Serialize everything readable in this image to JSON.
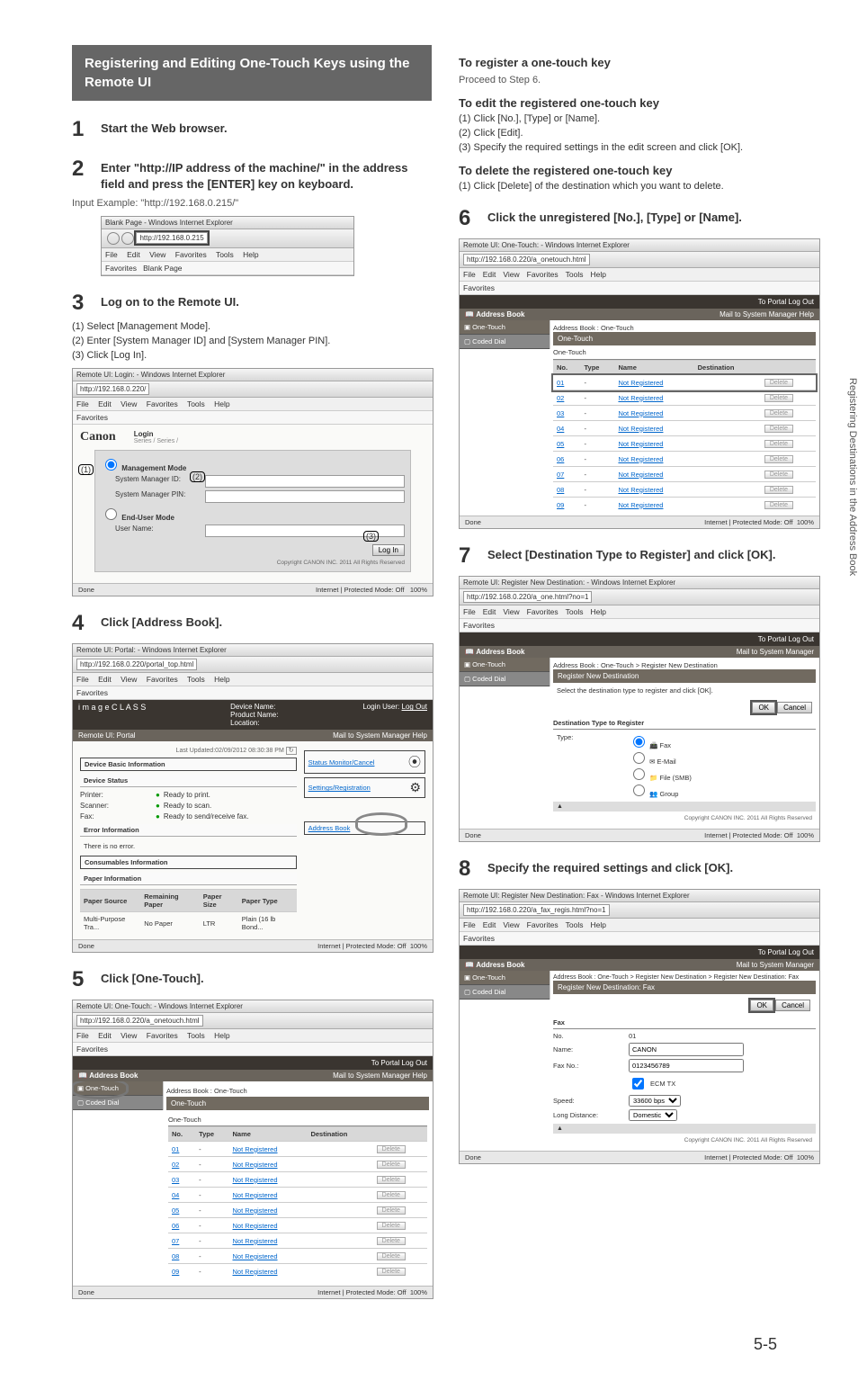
{
  "title": "Registering and Editing One-Touch Keys using the Remote UI",
  "side_tab": "Registering Destinations in the Address Book",
  "page_number": "5-5",
  "left": {
    "steps": {
      "s1": {
        "num": "1",
        "text": "Start the Web browser."
      },
      "s2": {
        "num": "2",
        "text": "Enter \"http://IP address of the machine/\" in the address field and press the [ENTER] key on keyboard.",
        "note": "Input Example: \"http://192.168.0.215/\""
      },
      "s3": {
        "num": "3",
        "text": "Log on to the Remote UI.",
        "sub1": "(1)  Select [Management Mode].",
        "sub2": "(2)  Enter [System Manager ID] and [System Manager PIN].",
        "sub3": "(3)  Click [Log In]."
      },
      "s4": {
        "num": "4",
        "text": "Click [Address Book]."
      },
      "s5": {
        "num": "5",
        "text": "Click [One-Touch]."
      }
    },
    "shot_browser": {
      "window_title": "Blank Page - Windows Internet Explorer",
      "url": "http://192.168.0.215",
      "menu": [
        "File",
        "Edit",
        "View",
        "Favorites",
        "Tools",
        "Help"
      ],
      "fav": "Favorites",
      "blank": "Blank Page"
    },
    "shot_login": {
      "window_title": "Remote UI: Login: - Windows Internet Explorer",
      "url": "http://192.168.0.220/",
      "brand": "Canon",
      "login_title": "Login",
      "series": "Series / Series /",
      "mgmt_mode": "Management Mode",
      "sys_id": "System Manager ID:",
      "sys_pin": "System Manager PIN:",
      "end_user": "End-User Mode",
      "user_name": "User Name:",
      "login_btn": "Log In",
      "copyright": "Copyright CANON INC. 2011 All Rights Reserved",
      "callouts": {
        "c1": "(1)",
        "c2": "(2)",
        "c3": "(3)"
      },
      "done": "Done",
      "status": "Internet | Protected Mode: Off",
      "zoom": "100%"
    },
    "shot_portal": {
      "window_title": "Remote UI: Portal: - Windows Internet Explorer",
      "portal": "Remote UI: Portal",
      "login_user": "Login User:",
      "mail_link": "Mail to System Manager  Help",
      "logout": "Log Out",
      "device_name": "Device Name:",
      "product_name": "Product Name:",
      "location": "Location:",
      "last_updated": "Last Updated:02/09/2012 08:30:38 PM",
      "status_monitor": "Status Monitor/Cancel",
      "settings_reg": "Settings/Registration",
      "address_book": "Address Book",
      "device_basic": "Device Basic Information",
      "device_status": "Device Status",
      "printer": "Printer:",
      "printer_v": "Ready to print.",
      "scanner": "Scanner:",
      "scanner_v": "Ready to scan.",
      "fax": "Fax:",
      "fax_v": "Ready to send/receive fax.",
      "error_info": "Error Information",
      "no_error": "There is no error.",
      "consumables": "Consumables Information",
      "paper_info": "Paper Information",
      "paper_source": "Paper Source",
      "remaining": "Remaining Paper",
      "paper_size": "Paper Size",
      "paper_type": "Paper Type",
      "mp_tray": "Multi-Purpose Tra...",
      "no_paper": "No Paper",
      "ltr": "LTR",
      "plain": "Plain (16\nlb Bond...",
      "done": "Done",
      "status": "Internet | Protected Mode: Off",
      "zoom": "100%"
    },
    "shot_ab": {
      "window_title": "Remote UI: One-Touch: - Windows Internet Explorer",
      "header": "Address Book",
      "mail_link": "Mail to System Manager  Help",
      "portal_link": "To Portal  Log Out",
      "nav1": "One-Touch",
      "nav2": "Coded Dial",
      "breadcrumb": "Address Book : One-Touch",
      "tab": "One-Touch",
      "list_header": "One-Touch",
      "cols": {
        "no": "No.",
        "type": "Type",
        "name": "Name",
        "dest": "Destination"
      },
      "rows": [
        {
          "no": "01",
          "type": "-",
          "name": "Not Registered"
        },
        {
          "no": "02",
          "type": "-",
          "name": "Not Registered"
        },
        {
          "no": "03",
          "type": "-",
          "name": "Not Registered"
        },
        {
          "no": "04",
          "type": "-",
          "name": "Not Registered"
        },
        {
          "no": "05",
          "type": "-",
          "name": "Not Registered"
        },
        {
          "no": "06",
          "type": "-",
          "name": "Not Registered"
        },
        {
          "no": "07",
          "type": "-",
          "name": "Not Registered"
        },
        {
          "no": "08",
          "type": "-",
          "name": "Not Registered"
        },
        {
          "no": "09",
          "type": "-",
          "name": "Not Registered"
        }
      ],
      "delete": "Delete",
      "done": "Done",
      "status": "Internet | Protected Mode: Off",
      "zoom": "100%"
    }
  },
  "right": {
    "reg": {
      "h": "To register a one-touch key",
      "t": "Proceed to Step 6."
    },
    "edit": {
      "h": "To edit the registered one-touch key",
      "s1": "(1)  Click [No.], [Type] or [Name].",
      "s2": "(2)  Click [Edit].",
      "s3": "(3)  Specify the required settings in the edit screen and click [OK]."
    },
    "del": {
      "h": "To delete the registered one-touch key",
      "s1": "(1)  Click [Delete] of the destination which you want to delete."
    },
    "steps": {
      "s6": {
        "num": "6",
        "text": "Click the unregistered [No.], [Type] or [Name]."
      },
      "s7": {
        "num": "7",
        "text": "Select [Destination Type to Register] and click [OK]."
      },
      "s8": {
        "num": "8",
        "text": "Specify the required settings and click [OK]."
      }
    },
    "shot6": {
      "header": "Address Book",
      "portal_link": "To Portal  Log Out",
      "mail_link": "Mail to System Manager  Help",
      "breadcrumb": "Address Book : One-Touch",
      "tab": "One-Touch",
      "list_header": "One-Touch",
      "cols": {
        "no": "No.",
        "type": "Type",
        "name": "Name",
        "dest": "Destination"
      },
      "rows": [
        {
          "no": "01",
          "name": "Not Registered"
        },
        {
          "no": "02",
          "name": "Not Registered"
        },
        {
          "no": "03",
          "name": "Not Registered"
        },
        {
          "no": "04",
          "name": "Not Registered"
        },
        {
          "no": "05",
          "name": "Not Registered"
        },
        {
          "no": "06",
          "name": "Not Registered"
        },
        {
          "no": "07",
          "name": "Not Registered"
        },
        {
          "no": "08",
          "name": "Not Registered"
        },
        {
          "no": "09",
          "name": "Not Registered"
        }
      ],
      "delete": "Delete"
    },
    "shot7": {
      "header": "Address Book",
      "portal_link": "To Portal  Log Out",
      "mail_link": "Mail to System Manager",
      "breadcrumb": "Address Book : One-Touch > Register New Destination",
      "section": "Register New Destination",
      "instr": "Select the destination type to register and click [OK].",
      "ok": "OK",
      "cancel": "Cancel",
      "dest_type": "Destination Type to Register",
      "type": "Type:",
      "opts": [
        "Fax",
        "E-Mail",
        "File (SMB)",
        "Group"
      ],
      "copyright": "Copyright CANON INC. 2011 All Rights Reserved"
    },
    "shot8": {
      "header": "Address Book",
      "portal_link": "To Portal  Log Out",
      "mail_link": "Mail to System Manager",
      "breadcrumb": "Address Book : One-Touch > Register New Destination > Register New Destination: Fax",
      "section": "Register New Destination: Fax",
      "ok": "OK",
      "cancel": "Cancel",
      "group": "Fax",
      "no": "No.",
      "no_v": "01",
      "name": "Name:",
      "name_v": "CANON",
      "faxno": "Fax No.:",
      "faxno_v": "0123456789",
      "ecm": "ECM TX",
      "speed": "Speed:",
      "speed_v": "33600 bps",
      "long": "Long Distance:",
      "long_v": "Domestic",
      "copyright": "Copyright CANON INC. 2011 All Rights Reserved"
    }
  }
}
